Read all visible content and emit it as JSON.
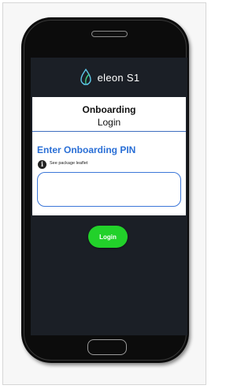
{
  "app": {
    "brand_name": "eleon S1",
    "logo_icon": "drop-leaf-icon",
    "colors": {
      "screen_bg": "#1b1f26",
      "accent_blue": "#2a6fd6",
      "login_green": "#22d12a"
    }
  },
  "card": {
    "title": "Onboarding",
    "subtitle": "Login"
  },
  "pin": {
    "heading": "Enter Onboarding PIN",
    "info_icon": "info-icon",
    "hint": "See package leaflet",
    "value": "",
    "placeholder": ""
  },
  "actions": {
    "login_label": "Login"
  }
}
